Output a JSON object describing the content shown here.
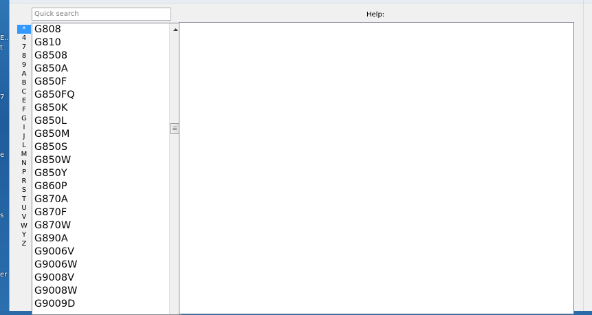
{
  "search": {
    "placeholder": "Quick search"
  },
  "help": {
    "label": "Help:"
  },
  "alphabet": [
    "*",
    "4",
    "7",
    "8",
    "9",
    "A",
    "B",
    "C",
    "E",
    "F",
    "G",
    "I",
    "J",
    "L",
    "M",
    "N",
    "P",
    "R",
    "S",
    "T",
    "U",
    "V",
    "W",
    "Y",
    "Z"
  ],
  "alphabet_selected": "*",
  "items": [
    "G808",
    "G810",
    "G8508",
    "G850A",
    "G850F",
    "G850FQ",
    "G850K",
    "G850L",
    "G850M",
    "G850S",
    "G850W",
    "G850Y",
    "G860P",
    "G870A",
    "G870F",
    "G870W",
    "G890A",
    "G9006V",
    "G9006W",
    "G9008V",
    "G9008W",
    "G9009D"
  ],
  "desktop_fragments": [
    "E..",
    "t",
    "7",
    "e",
    "s",
    "er"
  ],
  "colors": {
    "selection": "#3399ff",
    "window_bg": "#f0f0f0"
  }
}
